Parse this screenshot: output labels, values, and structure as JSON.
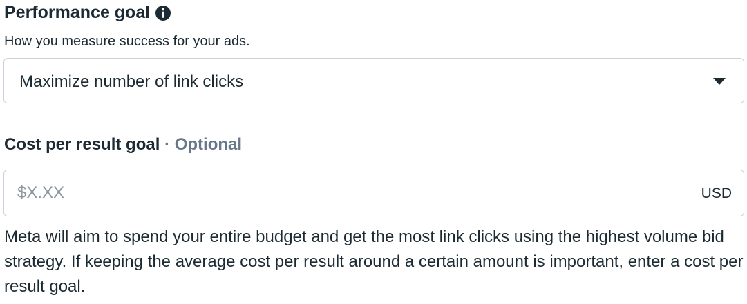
{
  "performance_goal": {
    "title": "Performance goal",
    "info_icon": "info-circle-icon",
    "subtitle": "How you measure success for your ads.",
    "selected_value": "Maximize number of link clicks",
    "dropdown_icon": "caret-down-icon"
  },
  "cost_goal": {
    "label": "Cost per result goal",
    "separator": "·",
    "optional": "Optional",
    "placeholder": "$X.XX",
    "value": "",
    "currency": "USD"
  },
  "help_text": "Meta will aim to spend your entire budget and get the most link clicks using the highest volume bid strategy. If keeping the average cost per result around a certain amount is important, enter a cost per result goal.",
  "colors": {
    "text": "#1c2b33",
    "muted": "#67788a",
    "border": "#cbd2d9"
  }
}
